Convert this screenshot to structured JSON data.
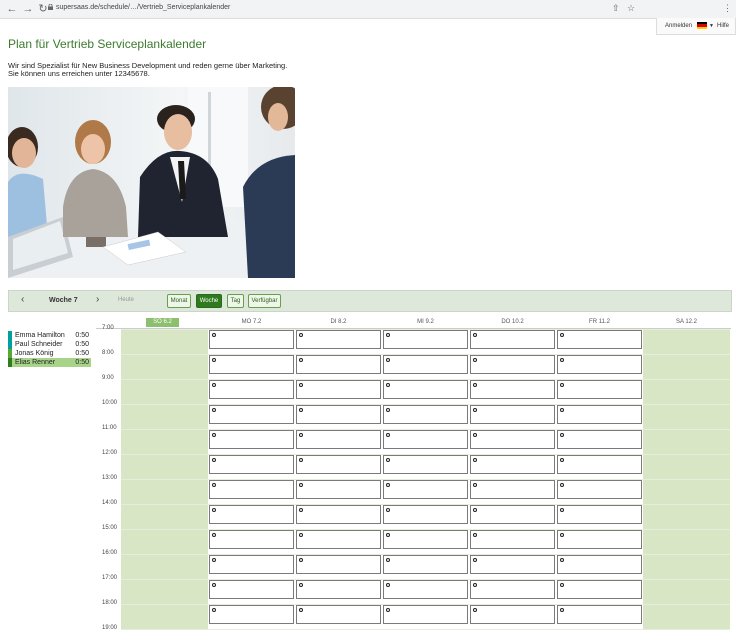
{
  "browser": {
    "url": "supersaas.de/schedule/…/Vertrieb_Serviceplankalender"
  },
  "topbar": {
    "login_label": "Anmelden",
    "help_label": "Hilfe"
  },
  "page": {
    "title": "Plan für Vertrieb Serviceplankalender",
    "intro_line1": "Wir sind Spezialist für New Business Development und reden gerne über Marketing.",
    "intro_line2": "Sie können uns erreichen unter 12345678."
  },
  "toolbar": {
    "week_label": "Woche 7",
    "today_label": "Heute",
    "month_label": "Monat",
    "week_view_label": "Woche",
    "day_label": "Tag",
    "available_label": "Verfügbar"
  },
  "resources": [
    {
      "name": "Emma Hamilton",
      "duration": "0:50",
      "color": "#00a0a0"
    },
    {
      "name": "Paul Schneider",
      "duration": "0:50",
      "color": "#00a0a0"
    },
    {
      "name": "Jonas König",
      "duration": "0:50",
      "color": "#5aa832"
    },
    {
      "name": "Elias Renner",
      "duration": "0:50",
      "color": "#2e7d1e"
    }
  ],
  "calendar": {
    "days": [
      "SO 6.2",
      "MO 7.2",
      "DI 8.2",
      "MI 9.2",
      "DO 10.2",
      "FR 11.2",
      "SA 12.2"
    ],
    "times": [
      "7:00",
      "8:00",
      "9:00",
      "10:00",
      "11:00",
      "12:00",
      "13:00",
      "14:00",
      "15:00",
      "16:00",
      "17:00",
      "18:00",
      "19:00"
    ],
    "weekend_color": "#d8e6c6",
    "today_color": "#8cbf6e"
  },
  "colors": {
    "accent": "#3d7a2e",
    "active_button": "#2f7a1f"
  }
}
